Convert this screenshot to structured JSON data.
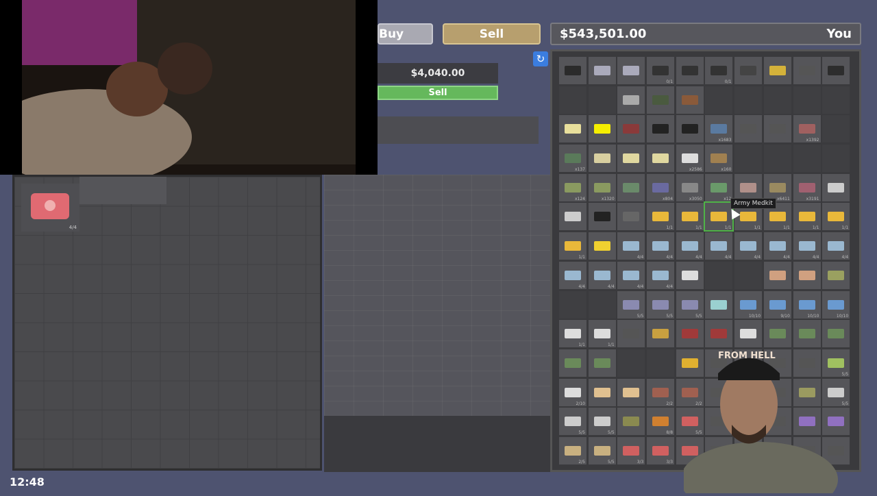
{
  "top_bar": {
    "buy_label": "Buy",
    "sell_label": "Sell"
  },
  "money": {
    "amount": "$543,501.00",
    "owner_label": "You"
  },
  "sell_panel": {
    "price": "$4,040.00",
    "sell_button": "Sell"
  },
  "tooltip": {
    "text": "Army Medkit"
  },
  "clock": {
    "time": "12:48"
  },
  "webcam": {
    "cap_text": "FROM HELL"
  },
  "icons": {
    "refresh": "refresh-icon",
    "medkit": "medkit-icon"
  },
  "colors": {
    "sell_accent": "#b79f6e",
    "confirm_green": "#65b85c",
    "refresh_blue": "#3b7de0"
  },
  "inventory": {
    "cells": [
      {
        "t": "item",
        "c": "#2b2b2b",
        "n": ""
      },
      {
        "t": "item",
        "c": "#aab",
        "n": ""
      },
      {
        "t": "item",
        "c": "#aab",
        "n": ""
      },
      {
        "t": "item",
        "c": "#333",
        "n": "0/1"
      },
      {
        "t": "item",
        "c": "#333",
        "n": ""
      },
      {
        "t": "item",
        "c": "#333",
        "n": "0/1"
      },
      {
        "t": "item",
        "c": "#444",
        "n": ""
      },
      {
        "t": "item",
        "c": "#d4b23a",
        "n": ""
      },
      {
        "t": "item",
        "c": "#555",
        "n": ""
      },
      {
        "t": "item",
        "c": "#2d2d2d",
        "n": ""
      },
      {
        "t": "empty",
        "c": "",
        "n": ""
      },
      {
        "t": "empty",
        "c": "",
        "n": ""
      },
      {
        "t": "item",
        "c": "#aaa",
        "n": ""
      },
      {
        "t": "item",
        "c": "#4a5a3f",
        "n": ""
      },
      {
        "t": "item",
        "c": "#8a5a3a",
        "n": ""
      },
      {
        "t": "empty",
        "c": "",
        "n": ""
      },
      {
        "t": "empty",
        "c": "",
        "n": ""
      },
      {
        "t": "empty",
        "c": "",
        "n": ""
      },
      {
        "t": "empty",
        "c": "",
        "n": ""
      },
      {
        "t": "empty",
        "c": "",
        "n": ""
      },
      {
        "t": "item",
        "c": "#e8df9c",
        "n": ""
      },
      {
        "t": "item",
        "c": "#f5ee00",
        "n": ""
      },
      {
        "t": "item",
        "c": "#8a3a3a",
        "n": ""
      },
      {
        "t": "item",
        "c": "#222",
        "n": ""
      },
      {
        "t": "item",
        "c": "#222",
        "n": ""
      },
      {
        "t": "item",
        "c": "#5a7aa0",
        "n": "x1683"
      },
      {
        "t": "item",
        "c": "#555",
        "n": ""
      },
      {
        "t": "item",
        "c": "#555",
        "n": ""
      },
      {
        "t": "item",
        "c": "#a06060",
        "n": "x1392"
      },
      {
        "t": "empty",
        "c": "",
        "n": ""
      },
      {
        "t": "item",
        "c": "#5a7a5a",
        "n": "x137"
      },
      {
        "t": "item",
        "c": "#d8cfa0",
        "n": ""
      },
      {
        "t": "item",
        "c": "#e0d8a0",
        "n": ""
      },
      {
        "t": "item",
        "c": "#e0d8a0",
        "n": ""
      },
      {
        "t": "item",
        "c": "#ddd",
        "n": "x2586"
      },
      {
        "t": "item",
        "c": "#a08050",
        "n": "x160"
      },
      {
        "t": "empty",
        "c": "",
        "n": ""
      },
      {
        "t": "empty",
        "c": "",
        "n": ""
      },
      {
        "t": "empty",
        "c": "",
        "n": ""
      },
      {
        "t": "empty",
        "c": "",
        "n": ""
      },
      {
        "t": "item",
        "c": "#8a9a60",
        "n": "x124"
      },
      {
        "t": "item",
        "c": "#8a9a60",
        "n": "x1320"
      },
      {
        "t": "item",
        "c": "#6a8a6a",
        "n": ""
      },
      {
        "t": "item",
        "c": "#6a6aa0",
        "n": "x804"
      },
      {
        "t": "item",
        "c": "#888",
        "n": "x3050"
      },
      {
        "t": "item",
        "c": "#6a9a6a",
        "n": "x12"
      },
      {
        "t": "item",
        "c": "#b0908a",
        "n": ""
      },
      {
        "t": "item",
        "c": "#9a8a60",
        "n": "x6411"
      },
      {
        "t": "item",
        "c": "#a06070",
        "n": "x3191"
      },
      {
        "t": "item",
        "c": "#ccc",
        "n": ""
      },
      {
        "t": "item",
        "c": "#ccc",
        "n": ""
      },
      {
        "t": "item",
        "c": "#222",
        "n": ""
      },
      {
        "t": "item",
        "c": "#666",
        "n": ""
      },
      {
        "t": "item",
        "c": "#e9b83a",
        "n": "1/1"
      },
      {
        "t": "item",
        "c": "#e9b83a",
        "n": "1/1"
      },
      {
        "t": "sel",
        "c": "#e9b83a",
        "n": "1/1"
      },
      {
        "t": "item",
        "c": "#e9b83a",
        "n": "1/1"
      },
      {
        "t": "item",
        "c": "#e9b83a",
        "n": "1/1"
      },
      {
        "t": "item",
        "c": "#e9b83a",
        "n": "1/1"
      },
      {
        "t": "item",
        "c": "#e9b83a",
        "n": "1/1"
      },
      {
        "t": "item",
        "c": "#e9b83a",
        "n": "1/1"
      },
      {
        "t": "item",
        "c": "#f0d030",
        "n": ""
      },
      {
        "t": "item",
        "c": "#9ab8d0",
        "n": "4/4"
      },
      {
        "t": "item",
        "c": "#9ab8d0",
        "n": "4/4"
      },
      {
        "t": "item",
        "c": "#9ab8d0",
        "n": "4/4"
      },
      {
        "t": "item",
        "c": "#9ab8d0",
        "n": "4/4"
      },
      {
        "t": "item",
        "c": "#9ab8d0",
        "n": "4/4"
      },
      {
        "t": "item",
        "c": "#9ab8d0",
        "n": "4/4"
      },
      {
        "t": "item",
        "c": "#9ab8d0",
        "n": "4/4"
      },
      {
        "t": "item",
        "c": "#9ab8d0",
        "n": "4/4"
      },
      {
        "t": "item",
        "c": "#9ab8d0",
        "n": "4/4"
      },
      {
        "t": "item",
        "c": "#9ab8d0",
        "n": "4/4"
      },
      {
        "t": "item",
        "c": "#9ab8d0",
        "n": "4/4"
      },
      {
        "t": "item",
        "c": "#9ab8d0",
        "n": "4/4"
      },
      {
        "t": "item",
        "c": "#ddd",
        "n": ""
      },
      {
        "t": "empty",
        "c": "",
        "n": ""
      },
      {
        "t": "empty",
        "c": "",
        "n": ""
      },
      {
        "t": "item",
        "c": "#d0a080",
        "n": ""
      },
      {
        "t": "item",
        "c": "#d0a080",
        "n": ""
      },
      {
        "t": "item",
        "c": "#9aa060",
        "n": ""
      },
      {
        "t": "empty",
        "c": "",
        "n": ""
      },
      {
        "t": "empty",
        "c": "",
        "n": ""
      },
      {
        "t": "item",
        "c": "#8a8ab0",
        "n": "5/5"
      },
      {
        "t": "item",
        "c": "#8a8ab0",
        "n": "5/5"
      },
      {
        "t": "item",
        "c": "#8a8ab0",
        "n": "5/5"
      },
      {
        "t": "item",
        "c": "#9ad0d0",
        "n": ""
      },
      {
        "t": "item",
        "c": "#6a9ad0",
        "n": "10/10"
      },
      {
        "t": "item",
        "c": "#6a9ad0",
        "n": "9/10"
      },
      {
        "t": "item",
        "c": "#6a9ad0",
        "n": "10/10"
      },
      {
        "t": "item",
        "c": "#6a9ad0",
        "n": "10/10"
      },
      {
        "t": "item",
        "c": "#ddd",
        "n": "1/1"
      },
      {
        "t": "item",
        "c": "#ddd",
        "n": "1/1"
      },
      {
        "t": "item",
        "c": "#555",
        "n": ""
      },
      {
        "t": "item",
        "c": "#c8a040",
        "n": ""
      },
      {
        "t": "item",
        "c": "#a03a3a",
        "n": ""
      },
      {
        "t": "item",
        "c": "#a03a3a",
        "n": ""
      },
      {
        "t": "item",
        "c": "#ddd",
        "n": ""
      },
      {
        "t": "item",
        "c": "#6a8a5a",
        "n": ""
      },
      {
        "t": "item",
        "c": "#6a8a5a",
        "n": ""
      },
      {
        "t": "item",
        "c": "#6a8a5a",
        "n": ""
      },
      {
        "t": "item",
        "c": "#6a8a5a",
        "n": ""
      },
      {
        "t": "item",
        "c": "#6a8a5a",
        "n": ""
      },
      {
        "t": "empty",
        "c": "",
        "n": ""
      },
      {
        "t": "empty",
        "c": "",
        "n": ""
      },
      {
        "t": "item",
        "c": "#e0b030",
        "n": ""
      },
      {
        "t": "item",
        "c": "#555",
        "n": ""
      },
      {
        "t": "item",
        "c": "#555",
        "n": ""
      },
      {
        "t": "item",
        "c": "#555",
        "n": ""
      },
      {
        "t": "item",
        "c": "#555",
        "n": ""
      },
      {
        "t": "item",
        "c": "#a0c060",
        "n": "5/5"
      },
      {
        "t": "item",
        "c": "#ddd",
        "n": "2/10"
      },
      {
        "t": "item",
        "c": "#e0c090",
        "n": ""
      },
      {
        "t": "item",
        "c": "#e0c090",
        "n": ""
      },
      {
        "t": "item",
        "c": "#a06050",
        "n": "2/2"
      },
      {
        "t": "item",
        "c": "#a06050",
        "n": "2/2"
      },
      {
        "t": "item",
        "c": "#555",
        "n": ""
      },
      {
        "t": "item",
        "c": "#555",
        "n": ""
      },
      {
        "t": "item",
        "c": "#555",
        "n": ""
      },
      {
        "t": "item",
        "c": "#9a9a60",
        "n": ""
      },
      {
        "t": "item",
        "c": "#ccc",
        "n": "5/5"
      },
      {
        "t": "item",
        "c": "#ccc",
        "n": "5/5"
      },
      {
        "t": "item",
        "c": "#ccc",
        "n": "5/5"
      },
      {
        "t": "item",
        "c": "#8a8a50",
        "n": ""
      },
      {
        "t": "item",
        "c": "#d08030",
        "n": "8/8"
      },
      {
        "t": "item",
        "c": "#d06060",
        "n": "5/5"
      },
      {
        "t": "item",
        "c": "#555",
        "n": ""
      },
      {
        "t": "item",
        "c": "#555",
        "n": ""
      },
      {
        "t": "item",
        "c": "#555",
        "n": ""
      },
      {
        "t": "item",
        "c": "#9070c0",
        "n": ""
      },
      {
        "t": "item",
        "c": "#9070c0",
        "n": ""
      },
      {
        "t": "item",
        "c": "#c8b080",
        "n": "2/5"
      },
      {
        "t": "item",
        "c": "#c8b080",
        "n": "5/5"
      },
      {
        "t": "item",
        "c": "#d06060",
        "n": "3/3"
      },
      {
        "t": "item",
        "c": "#d06060",
        "n": "3/3"
      },
      {
        "t": "item",
        "c": "#d06060",
        "n": ""
      },
      {
        "t": "item",
        "c": "#555",
        "n": ""
      },
      {
        "t": "item",
        "c": "#555",
        "n": ""
      },
      {
        "t": "item",
        "c": "#555",
        "n": ""
      },
      {
        "t": "item",
        "c": "#555",
        "n": ""
      },
      {
        "t": "item",
        "c": "#555",
        "n": ""
      }
    ]
  },
  "left_panel": {
    "item_count": "4/4"
  }
}
